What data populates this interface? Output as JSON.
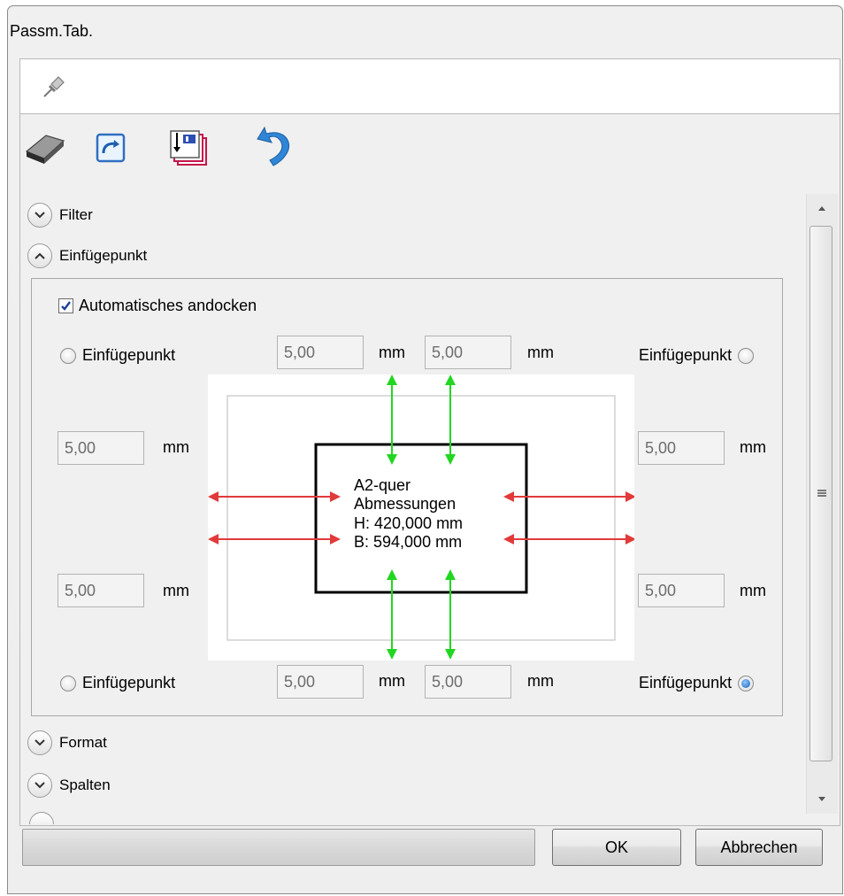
{
  "window": {
    "title": "Passm.Tab."
  },
  "pin": {
    "icon": "pushpin-icon"
  },
  "toolbar": {
    "items": [
      {
        "name": "eraser-button",
        "icon": "eraser-icon"
      },
      {
        "name": "refresh-button",
        "icon": "refresh-icon"
      },
      {
        "name": "save-button",
        "icon": "save-import-icon"
      },
      {
        "name": "undo-button",
        "icon": "undo-icon"
      }
    ]
  },
  "sections": {
    "filter": "Filter",
    "einfuegepunkt": "Einfügepunkt",
    "format": "Format",
    "spalten": "Spalten"
  },
  "insert": {
    "auto_dock_label": "Automatisches andocken",
    "auto_dock_checked": true,
    "radio_label": "Einfügepunkt",
    "unit": "mm",
    "top_left_value": "5,00",
    "top_right_value": "5,00",
    "left_top_value": "5,00",
    "left_bottom_value": "5,00",
    "right_top_value": "5,00",
    "right_bottom_value": "5,00",
    "bottom_left_value": "5,00",
    "bottom_right_value": "5,00",
    "selected_radio": "bottom-right",
    "preview": {
      "line1": "A2-quer",
      "line2": "Abmessungen",
      "line3": "H: 420,000 mm",
      "line4": "B: 594,000 mm"
    }
  },
  "footer": {
    "ok_label": "OK",
    "cancel_label": "Abbrechen"
  },
  "colors": {
    "green_arrow": "#22d622",
    "red_arrow": "#e23a3a",
    "radio_selected": "#1d62b5",
    "check_color": "#203f9a"
  }
}
